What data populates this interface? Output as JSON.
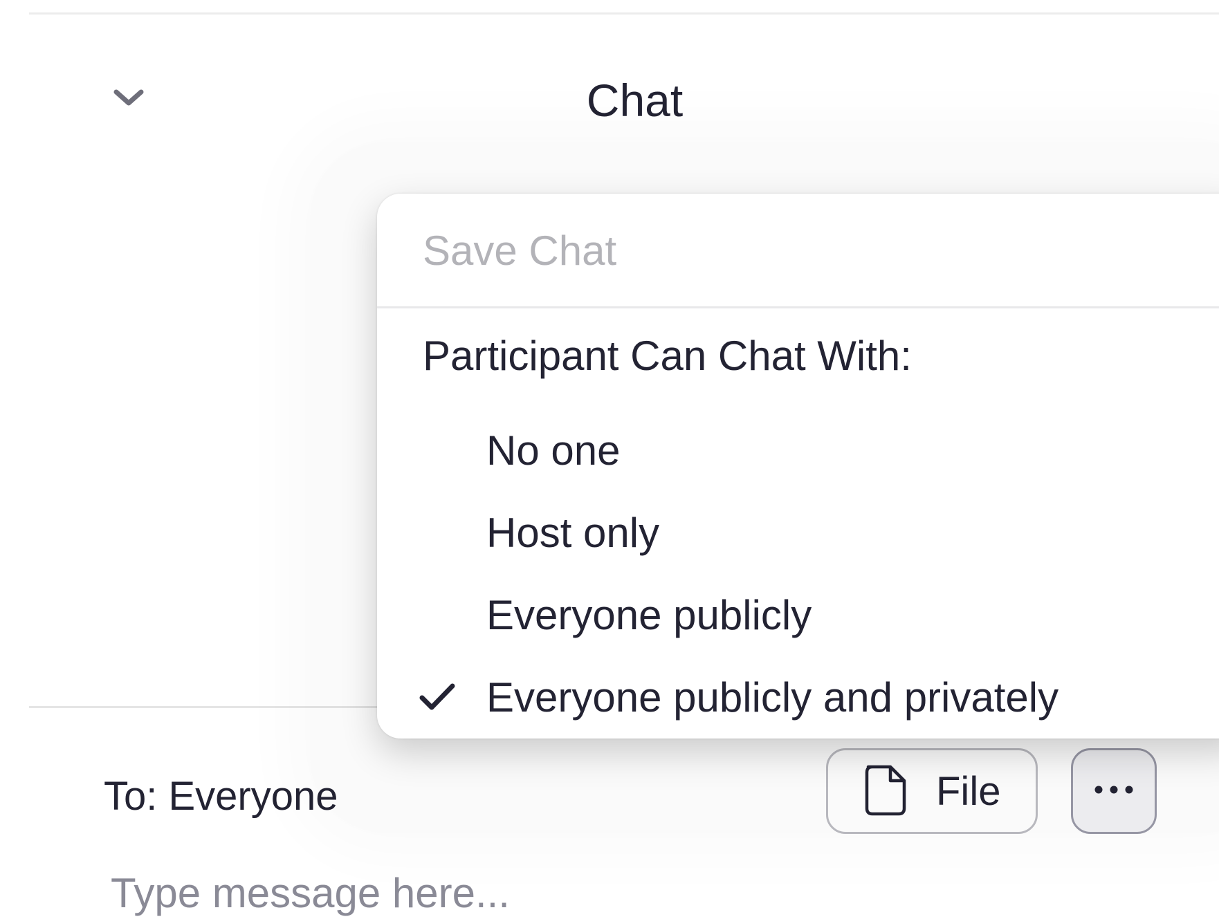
{
  "header": {
    "title": "Chat",
    "collapse_icon": "chevron-down-icon"
  },
  "menu": {
    "save_chat": "Save Chat",
    "save_chat_enabled": false,
    "section_header": "Participant Can Chat With:",
    "options": [
      {
        "label": "No one",
        "checked": false
      },
      {
        "label": "Host only",
        "checked": false
      },
      {
        "label": "Everyone publicly",
        "checked": false
      },
      {
        "label": "Everyone publicly and privately",
        "checked": true
      }
    ],
    "check_icon": "checkmark-icon"
  },
  "composer": {
    "to_label": "To: Everyone",
    "file_button_label": "File",
    "file_icon": "file-icon",
    "more_icon": "more-dots-icon",
    "message_placeholder": "Type message here...",
    "message_value": ""
  },
  "colors": {
    "text_primary": "#232333",
    "text_disabled": "#b3b3b8",
    "placeholder": "#8a8a96",
    "button_border": "#bcbcc2",
    "more_button_bg": "#f1f1f4"
  }
}
